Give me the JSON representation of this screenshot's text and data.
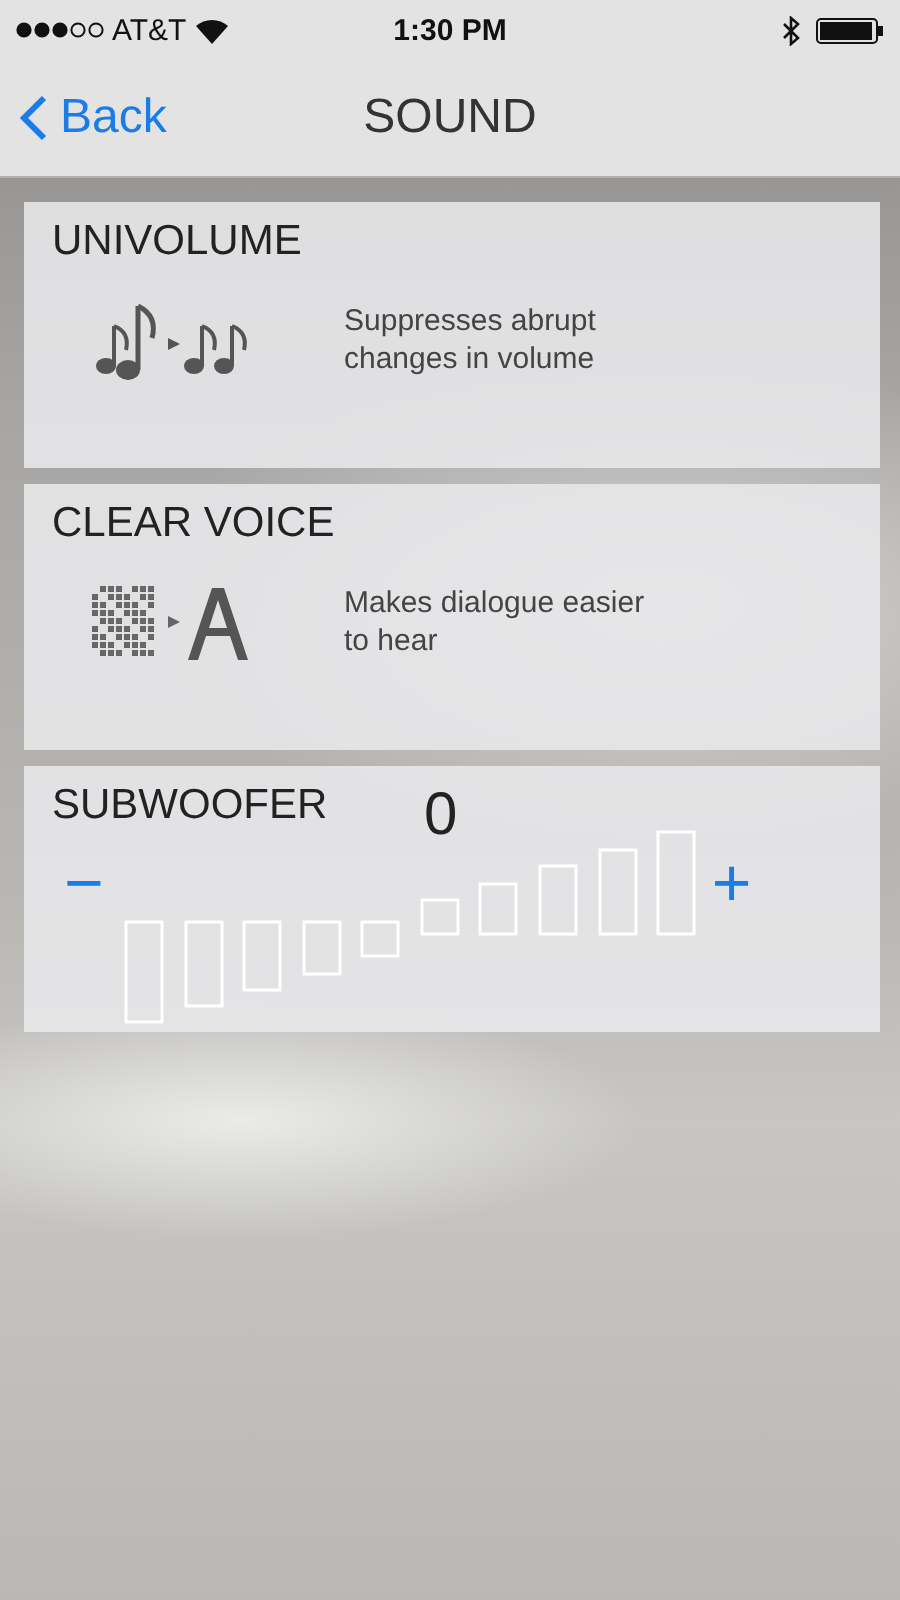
{
  "status_bar": {
    "carrier": "AT&T",
    "time": "1:30 PM"
  },
  "nav": {
    "back": "Back",
    "title": "SOUND"
  },
  "cards": [
    {
      "kind": "feature",
      "title": "UNIVOLUME",
      "description": "Suppresses abrupt changes in volume"
    },
    {
      "kind": "feature",
      "title": "CLEAR VOICE",
      "description": "Makes dialogue easier to hear"
    },
    {
      "kind": "stepper",
      "title": "SUBWOOFER",
      "value": "0",
      "minus": "−",
      "plus": "+"
    }
  ]
}
